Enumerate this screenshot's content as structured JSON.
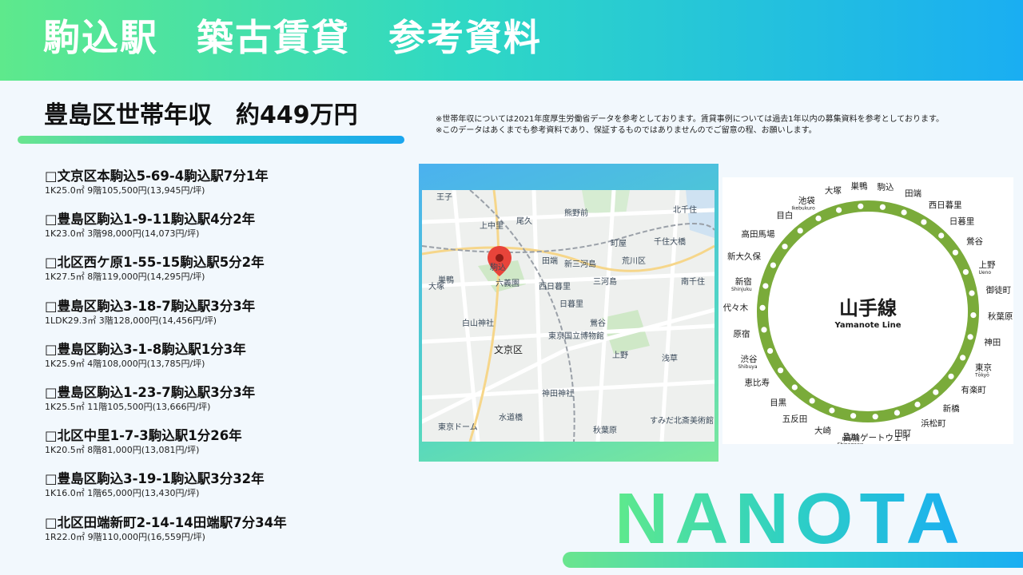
{
  "header": {
    "title": "駒込駅　築古賃貸　参考資料"
  },
  "income": {
    "title": "豊島区世帯年収　約449万円"
  },
  "notes": [
    "※世帯年収については2021年度厚生労働省データを参考としております。賃貸事例については過去1年以内の募集資料を参考としております。",
    "※このデータはあくまでも参考資料であり、保証するものではありませんのでご留意の程、お願いします。"
  ],
  "listings": [
    {
      "title": "□文京区本駒込5-69-4駒込駅7分1年",
      "detail": "1K25.0㎡ 9階105,500円(13,945円/坪)"
    },
    {
      "title": "□豊島区駒込1-9-11駒込駅4分2年",
      "detail": "1K23.0㎡ 3階98,000円(14,073円/坪)"
    },
    {
      "title": "□北区西ケ原1-55-15駒込駅5分2年",
      "detail": "1K27.5㎡ 8階119,000円(14,295円/坪)"
    },
    {
      "title": "□豊島区駒込3-18-7駒込駅3分3年",
      "detail": "1LDK29.3㎡ 3階128,000円(14,456円/坪)"
    },
    {
      "title": "□豊島区駒込3-1-8駒込駅1分3年",
      "detail": "1K25.9㎡ 4階108,000円(13,785円/坪)"
    },
    {
      "title": "□豊島区駒込1-23-7駒込駅3分3年",
      "detail": "1K25.5㎡ 11階105,500円(13,666円/坪)"
    },
    {
      "title": "□北区中里1-7-3駒込駅1分26年",
      "detail": "1K20.5㎡ 8階81,000円(13,081円/坪)"
    },
    {
      "title": "□豊島区駒込3-19-1駒込駅3分32年",
      "detail": "1K16.0㎡ 1階65,000円(13,430円/坪)"
    },
    {
      "title": "□北区田端新町2-14-14田端駅7分34年",
      "detail": "1R22.0㎡ 9階110,000円(16,559円/坪)"
    }
  ],
  "map": {
    "labels": {
      "oji": "王子",
      "kaminakazato": "上中里",
      "oku": "尾久",
      "kumanomae": "熊野前",
      "kitasenju": "北千住",
      "komagome": "駒込",
      "tabata": "田端",
      "nishinippori": "西日暮里",
      "nippori": "日暮里",
      "sugamo": "巣鴨",
      "otsuka": "大塚",
      "machiya": "町屋",
      "senjuohashi": "千住大橋",
      "rikugien": "六義園",
      "hakusan": "白山神社",
      "bunkyo": "文京区",
      "uguisudani": "鶯谷",
      "museum": "東京国立博物館",
      "kanda": "神田神社",
      "akihabara": "秋葉原",
      "ueno": "上野",
      "minamisenju": "南千住",
      "asakusa": "浅草",
      "mikawajima": "三河島",
      "shinmikawajima": "新三河島",
      "arakawa": "荒川区",
      "sumida": "すみだ北斎美術館",
      "suidobashi": "水道橋",
      "tokyodome": "東京ドーム"
    },
    "pin_color": "#e8443a"
  },
  "yamanote": {
    "title": "山手線",
    "subtitle": "Yamanote Line",
    "line_color": "#7aab3a",
    "stations": [
      {
        "name": "駒込"
      },
      {
        "name": "田端"
      },
      {
        "name": "西日暮里"
      },
      {
        "name": "日暮里"
      },
      {
        "name": "鶯谷"
      },
      {
        "name": "上野",
        "roman": "Ueno"
      },
      {
        "name": "御徒町"
      },
      {
        "name": "秋葉原"
      },
      {
        "name": "神田"
      },
      {
        "name": "東京",
        "roman": "Tōkyō"
      },
      {
        "name": "有楽町"
      },
      {
        "name": "新橋"
      },
      {
        "name": "浜松町"
      },
      {
        "name": "田町"
      },
      {
        "name": "高輪ゲートウェイ"
      },
      {
        "name": "品川",
        "roman": "Shinagawa"
      },
      {
        "name": "大崎"
      },
      {
        "name": "五反田"
      },
      {
        "name": "目黒"
      },
      {
        "name": "恵比寿"
      },
      {
        "name": "渋谷",
        "roman": "Shibuya"
      },
      {
        "name": "原宿"
      },
      {
        "name": "代々木"
      },
      {
        "name": "新宿",
        "roman": "Shinjuku"
      },
      {
        "name": "新大久保"
      },
      {
        "name": "高田馬場"
      },
      {
        "name": "目白"
      },
      {
        "name": "池袋",
        "roman": "Ikebukuro"
      },
      {
        "name": "大塚"
      },
      {
        "name": "巣鴨"
      }
    ]
  },
  "logo": {
    "text": "NANOTA"
  }
}
